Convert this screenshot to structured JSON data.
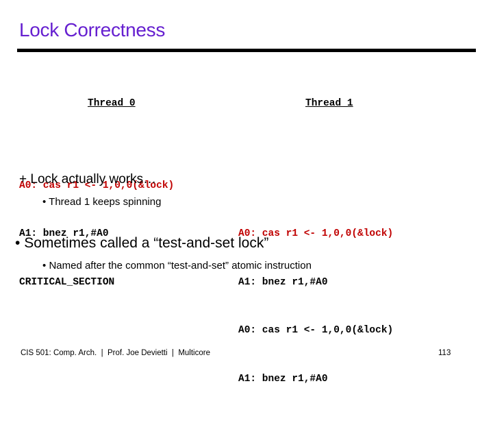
{
  "slide": {
    "title": "Lock Correctness",
    "title_color": "#6620D0",
    "rule_color": "#000000",
    "highlight_color": "#C00000",
    "text_color": "#000000"
  },
  "columns": [
    {
      "heading": "Thread 0",
      "lines": [
        {
          "text": "A0: cas r1 <- 1,0,0(&lock)",
          "highlighted": true
        },
        {
          "text": "A1: bnez r1,#A0",
          "highlighted": false
        },
        {
          "text": "CRITICAL_SECTION",
          "highlighted": false
        }
      ]
    },
    {
      "heading": "Thread 1",
      "lines": [
        {
          "text": "",
          "highlighted": false,
          "blank": true
        },
        {
          "text": "A0: cas r1 <- 1,0,0(&lock)",
          "highlighted": true
        },
        {
          "text": "A1: bnez r1,#A0",
          "highlighted": false
        },
        {
          "text": "A0: cas r1 <- 1,0,0(&lock)",
          "highlighted": false
        },
        {
          "text": "A1: bnez r1,#A0",
          "highlighted": false
        }
      ]
    }
  ],
  "bullets": {
    "works": {
      "marker": "+",
      "text": "Lock actually works…"
    },
    "spinning": {
      "marker": "•",
      "text": "Thread 1 keeps spinning"
    },
    "tas": {
      "marker": "•",
      "text": "Sometimes called a “test-and-set lock”"
    },
    "named": {
      "marker": "•",
      "text": "Named after the common “test-and-set” atomic instruction"
    }
  },
  "footer": {
    "text": "CIS 501: Comp. Arch.  |  Prof. Joe Devietti  |  Multicore",
    "page_number": "113"
  }
}
